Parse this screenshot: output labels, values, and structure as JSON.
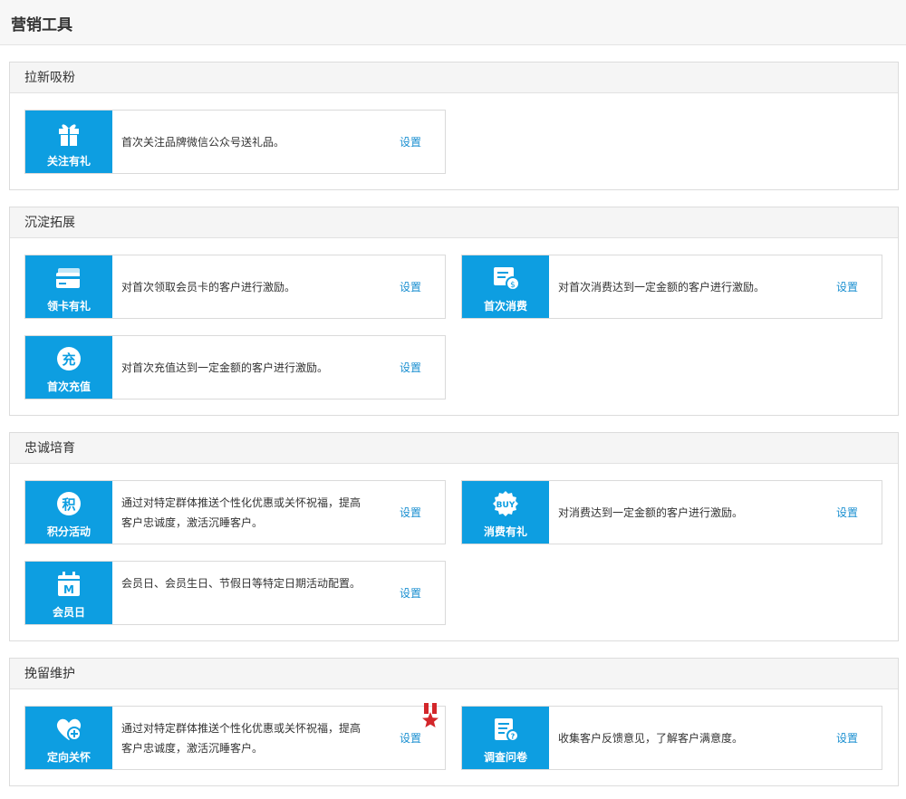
{
  "page": {
    "title": "营销工具"
  },
  "sections": [
    {
      "title": "拉新吸粉",
      "cards": [
        {
          "icon": "gift-icon",
          "label": "关注有礼",
          "desc": "首次关注品牌微信公众号送礼品。",
          "link": "设置"
        }
      ]
    },
    {
      "title": "沉淀拓展",
      "cards": [
        {
          "icon": "card-icon",
          "label": "领卡有礼",
          "desc": "对首次领取会员卡的客户进行激励。",
          "link": "设置"
        },
        {
          "icon": "receipt-coin-icon",
          "label": "首次消费",
          "desc": "对首次消费达到一定金额的客户进行激励。",
          "link": "设置"
        },
        {
          "icon": "recharge-icon",
          "label": "首次充值",
          "desc": "对首次充值达到一定金额的客户进行激励。",
          "link": "设置"
        }
      ]
    },
    {
      "title": "忠诚培育",
      "cards": [
        {
          "icon": "points-icon",
          "label": "积分活动",
          "desc": "通过对特定群体推送个性化优惠或关怀祝福，提高客户忠诚度，激活沉睡客户。",
          "link": "设置"
        },
        {
          "icon": "buy-badge-icon",
          "label": "消费有礼",
          "desc": "对消费达到一定金额的客户进行激励。",
          "link": "设置"
        },
        {
          "icon": "calendar-m-icon",
          "label": "会员日",
          "desc": "会员日、会员生日、节假日等特定日期活动配置。",
          "link": "设置"
        }
      ]
    },
    {
      "title": "挽留维护",
      "cards": [
        {
          "icon": "heart-plus-icon",
          "label": "定向关怀",
          "desc": "通过对特定群体推送个性化优惠或关怀祝福，提高客户忠诚度，激活沉睡客户。",
          "link": "设置",
          "badge": "star-ribbon-icon"
        },
        {
          "icon": "survey-icon",
          "label": "调查问卷",
          "desc": "收集客户反馈意见，了解客户满意度。",
          "link": "设置"
        }
      ]
    }
  ],
  "colors": {
    "accent": "#0d9ee1",
    "link": "#1a8fd0",
    "badge": "#d3262a"
  }
}
